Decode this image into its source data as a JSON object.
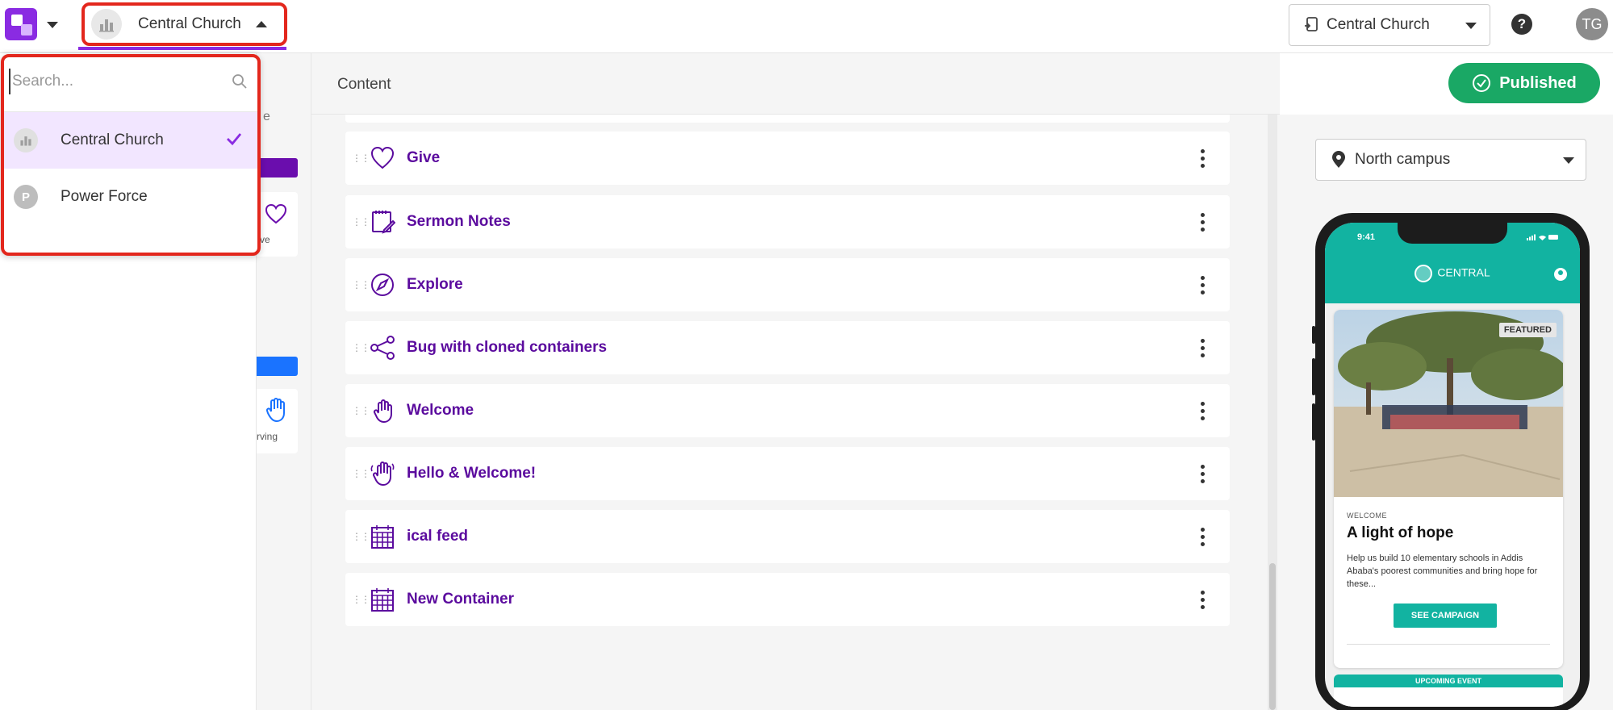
{
  "topbar": {
    "org_name": "Central Church",
    "campus_name": "Central Church",
    "help": "?",
    "user_initials": "TG"
  },
  "dropdown": {
    "search_placeholder": "Search...",
    "items": [
      {
        "label": "Central Church",
        "selected": true
      },
      {
        "label": "Power Force",
        "avatar_letter": "P",
        "selected": false
      }
    ]
  },
  "sidebar": {
    "partial_text_1": "e",
    "card1_label": "ve",
    "card2_label": "rving"
  },
  "content": {
    "title": "Content",
    "items": [
      {
        "label": "Give",
        "icon": "heart-icon"
      },
      {
        "label": "Sermon Notes",
        "icon": "notes-icon"
      },
      {
        "label": "Explore",
        "icon": "compass-icon"
      },
      {
        "label": "Bug with cloned containers",
        "icon": "share-icon"
      },
      {
        "label": "Welcome",
        "icon": "hand-icon"
      },
      {
        "label": "Hello & Welcome!",
        "icon": "hand-wave-icon"
      },
      {
        "label": "ical feed",
        "icon": "calendar-icon"
      },
      {
        "label": "New Container",
        "icon": "calendar-icon"
      }
    ]
  },
  "status": {
    "published_label": "Published"
  },
  "preview": {
    "location": "North campus",
    "phone": {
      "time": "9:41",
      "brand": "CENTRAL",
      "featured_badge": "FEATURED",
      "section_label": "WELCOME",
      "title": "A light of hope",
      "body": "Help us build 10 elementary schools in Addis Ababa's poorest communities and bring hope for these...",
      "cta": "SEE CAMPAIGN",
      "upcoming": "UPCOMING EVENT"
    }
  },
  "colors": {
    "brand_purple": "#8a2be2",
    "item_purple": "#5b0b9e",
    "highlight_red": "#e3271d",
    "published_green": "#1aa865",
    "teal": "#12b3a1"
  }
}
